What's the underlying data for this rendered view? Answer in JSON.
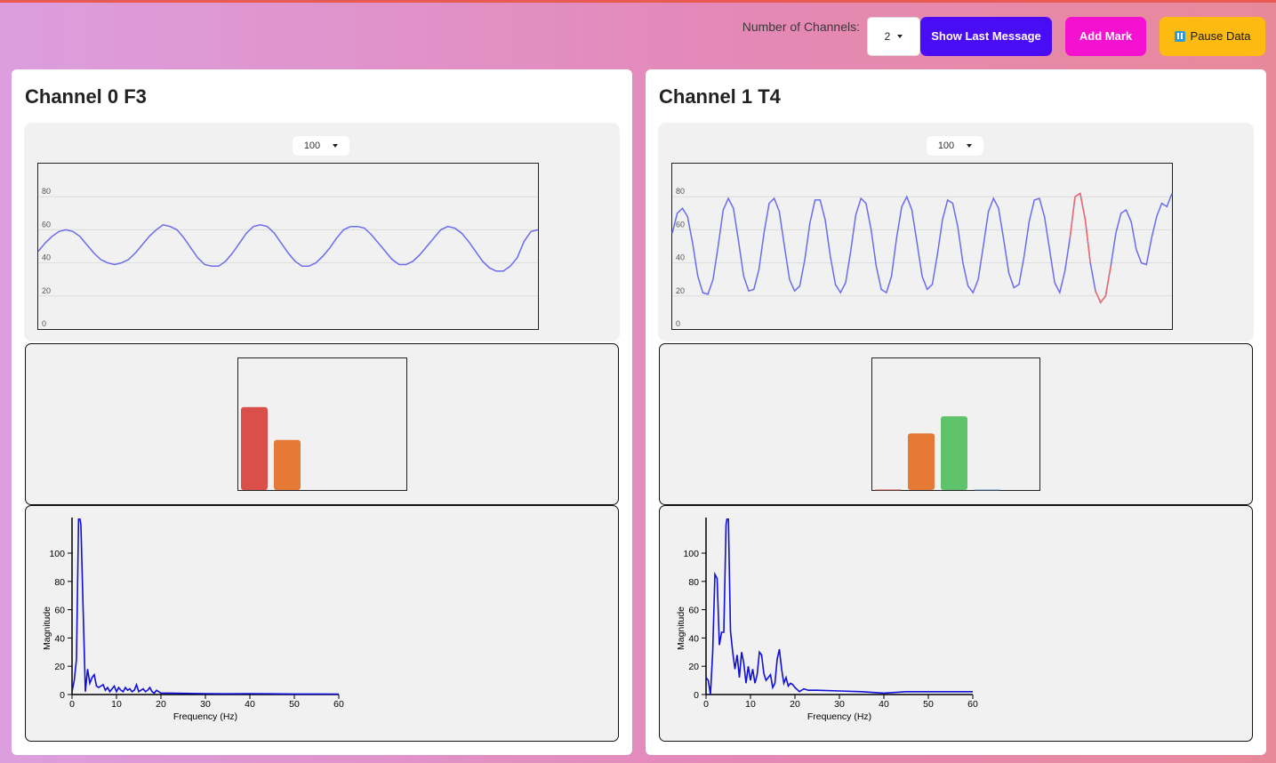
{
  "toolbar": {
    "channels_label": "Number of Channels:",
    "channels_value": "2",
    "show_last_message": "Show Last Message",
    "add_mark": "Add Mark",
    "pause_data": "Pause Data",
    "colors": {
      "show": "#4a0cf5",
      "mark": "#f511d0",
      "pause": "#fdba10"
    }
  },
  "channels": [
    {
      "title": "Channel 0 F3",
      "window_select": "100",
      "timeseries": {
        "yticks": [
          "80",
          "60",
          "40",
          "20",
          "0"
        ],
        "ylim": [
          0,
          100
        ],
        "line_color": "#6b6bf0",
        "values": [
          47,
          52,
          56,
          59,
          60,
          59,
          56,
          51,
          46,
          42,
          40,
          39,
          40,
          42,
          46,
          51,
          56,
          60,
          63,
          62,
          60,
          55,
          49,
          43,
          39,
          38,
          38,
          41,
          46,
          52,
          58,
          62,
          63,
          62,
          58,
          52,
          46,
          41,
          38,
          38,
          40,
          44,
          49,
          55,
          60,
          62,
          62,
          61,
          57,
          52,
          47,
          42,
          39,
          39,
          41,
          45,
          50,
          55,
          60,
          62,
          61,
          58,
          53,
          47,
          41,
          37,
          35,
          35,
          38,
          43,
          53,
          59,
          60
        ],
        "highlights": []
      },
      "bands": [
        {
          "value": 63,
          "color": "#db4f4a"
        },
        {
          "value": 38,
          "color": "#e67935"
        }
      ],
      "fft": {
        "ylabel": "Magnitude",
        "xlabel": "Frequency (Hz)",
        "xticks": [
          "0",
          "10",
          "20",
          "30",
          "40",
          "50",
          "60"
        ],
        "yticks": [
          "0",
          "20",
          "40",
          "60",
          "80",
          "100"
        ],
        "xlim": [
          0,
          60
        ],
        "ylim": [
          0,
          100
        ],
        "line_color": "#1010d8",
        "x": [
          0,
          0.5,
          1,
          1.5,
          2,
          2.5,
          3,
          3.5,
          4,
          4.5,
          5,
          5.5,
          6,
          6.5,
          7,
          7.5,
          8,
          8.5,
          9,
          9.5,
          10,
          10.5,
          11,
          11.5,
          12,
          12.5,
          13,
          13.5,
          14,
          14.5,
          15,
          15.5,
          16,
          16.5,
          17,
          17.5,
          18,
          18.5,
          19,
          19.5,
          20,
          21,
          22,
          25,
          30,
          35,
          40,
          45,
          50,
          55,
          60
        ],
        "y": [
          2,
          10,
          25,
          130,
          120,
          60,
          2,
          18,
          8,
          12,
          14,
          6,
          5,
          6,
          7,
          3,
          5,
          2,
          4,
          6,
          2,
          5,
          3,
          2,
          5,
          3,
          4,
          2,
          3,
          7,
          2,
          3,
          4,
          2,
          3,
          5,
          2,
          1,
          3,
          2,
          1,
          1,
          1,
          0.8,
          0.6,
          0.5,
          0.6,
          0.5,
          0.4,
          0.4,
          0.3
        ]
      }
    },
    {
      "title": "Channel 1 T4",
      "window_select": "100",
      "timeseries": {
        "yticks": [
          "80",
          "60",
          "40",
          "20",
          "0"
        ],
        "ylim": [
          0,
          100
        ],
        "line_color": "#6b6bf0",
        "values": [
          58,
          70,
          73,
          68,
          52,
          32,
          22,
          21,
          30,
          50,
          72,
          79,
          73,
          53,
          32,
          23,
          24,
          36,
          58,
          76,
          79,
          71,
          50,
          30,
          23,
          26,
          42,
          64,
          78,
          78,
          66,
          44,
          27,
          22,
          28,
          47,
          69,
          79,
          76,
          60,
          38,
          24,
          22,
          32,
          55,
          74,
          80,
          72,
          52,
          32,
          24,
          27,
          45,
          66,
          78,
          76,
          62,
          40,
          26,
          22,
          30,
          50,
          71,
          79,
          73,
          54,
          34,
          25,
          27,
          44,
          65,
          78,
          79,
          68,
          48,
          28,
          22,
          35,
          55,
          80,
          82,
          66,
          40,
          23,
          16,
          20,
          38,
          58,
          70,
          72,
          65,
          48,
          40,
          39,
          55,
          68,
          76,
          74,
          82
        ],
        "highlights": [
          {
            "from": 78,
            "to": 82,
            "color": "#f06a6a"
          },
          {
            "from": 83,
            "to": 86,
            "color": "#f06a6a"
          }
        ]
      },
      "bands": [
        {
          "value": 0.5,
          "color": "#f08080"
        },
        {
          "value": 43,
          "color": "#e67935"
        },
        {
          "value": 56,
          "color": "#5ec36a"
        },
        {
          "value": 0.5,
          "color": "#8fb8e8"
        }
      ],
      "fft": {
        "ylabel": "Magnitude",
        "xlabel": "Frequency (Hz)",
        "xticks": [
          "0",
          "10",
          "20",
          "30",
          "40",
          "50",
          "60"
        ],
        "yticks": [
          "0",
          "20",
          "40",
          "60",
          "80",
          "100"
        ],
        "xlim": [
          0,
          60
        ],
        "ylim": [
          0,
          100
        ],
        "line_color": "#1010d8",
        "x": [
          0,
          0.5,
          1,
          1.5,
          2,
          2.5,
          3,
          3.5,
          4,
          4.5,
          5,
          5.5,
          6,
          6.5,
          7,
          7.5,
          8,
          8.5,
          9,
          9.5,
          10,
          10.5,
          11,
          11.5,
          12,
          12.5,
          13,
          13.5,
          14,
          14.5,
          15,
          15.5,
          16,
          16.5,
          17,
          17.5,
          18,
          18.5,
          19,
          19.5,
          20,
          21,
          22,
          23,
          25,
          30,
          35,
          40,
          45,
          50,
          55,
          60
        ],
        "y": [
          12,
          10,
          0,
          30,
          85,
          82,
          35,
          44,
          44,
          120,
          130,
          45,
          30,
          18,
          28,
          12,
          30,
          22,
          8,
          20,
          10,
          18,
          8,
          14,
          30,
          28,
          15,
          10,
          12,
          14,
          5,
          8,
          25,
          32,
          18,
          8,
          12,
          6,
          8,
          7,
          5,
          2,
          4,
          3,
          3,
          2.5,
          2,
          1,
          2,
          2,
          2,
          2
        ]
      }
    }
  ]
}
